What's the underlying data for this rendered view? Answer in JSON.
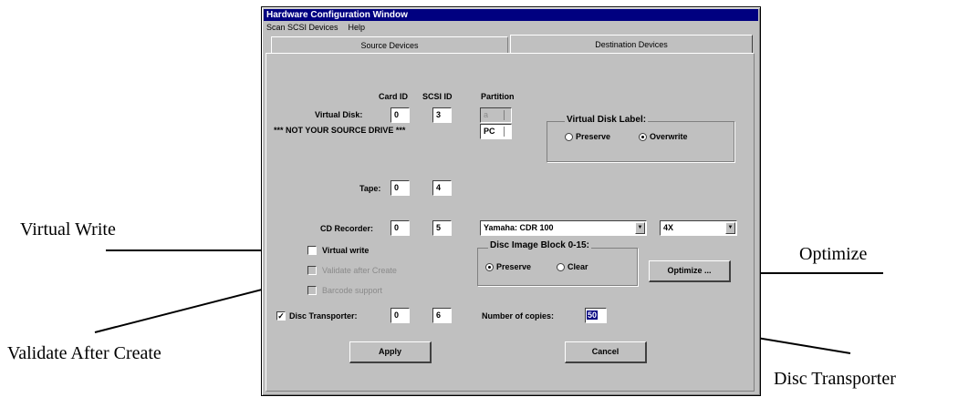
{
  "callouts": {
    "virtual_write": "Virtual Write",
    "validate_after_create": "Validate After Create",
    "optimize": "Optimize",
    "disc_transporter": "Disc Transporter"
  },
  "window": {
    "title": "Hardware Configuration Window",
    "menu": [
      "Scan SCSI Devices",
      "Help"
    ],
    "tabs": {
      "source": "Source Devices",
      "destination": "Destination Devices",
      "active": "destination"
    }
  },
  "headers": {
    "card_id": "Card ID",
    "scsi_id": "SCSI ID",
    "partition": "Partition"
  },
  "virtual_disk": {
    "label": "Virtual Disk:",
    "card_id": "0",
    "scsi_id": "3",
    "partition": "a",
    "format": "PC",
    "warning": "*** NOT YOUR SOURCE DRIVE ***",
    "label_group": {
      "title": "Virtual Disk Label:",
      "preserve": "Preserve",
      "overwrite": "Overwrite",
      "selected": "overwrite"
    }
  },
  "tape": {
    "label": "Tape:",
    "card_id": "0",
    "scsi_id": "4"
  },
  "cd_recorder": {
    "label": "CD Recorder:",
    "card_id": "0",
    "scsi_id": "5",
    "model": "Yamaha: CDR 100",
    "speed": "4X"
  },
  "options": {
    "virtual_write": {
      "label": "Virtual write",
      "checked": false
    },
    "validate_after_create": {
      "label": "Validate after Create",
      "checked": false,
      "enabled": false
    },
    "barcode_support": {
      "label": "Barcode support",
      "checked": false,
      "enabled": false
    }
  },
  "disc_image_block": {
    "title": "Disc Image Block 0-15:",
    "preserve": "Preserve",
    "clear": "Clear",
    "selected": "preserve"
  },
  "optimize_button": "Optimize ...",
  "disc_transporter": {
    "label": "Disc Transporter:",
    "checked": true,
    "card_id": "0",
    "scsi_id": "6"
  },
  "copies": {
    "label": "Number of copies:",
    "value": "50"
  },
  "buttons": {
    "apply": "Apply",
    "cancel": "Cancel"
  }
}
